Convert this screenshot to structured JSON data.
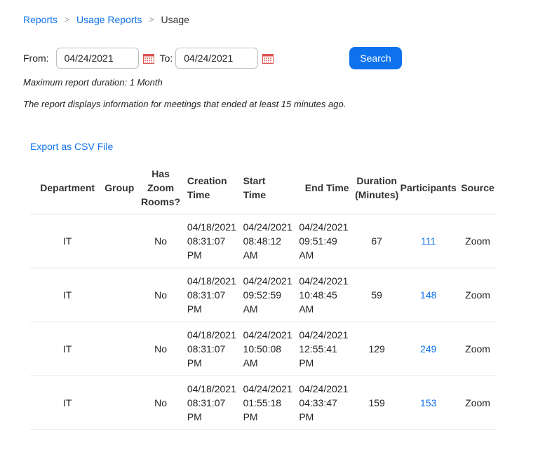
{
  "breadcrumb": {
    "items": [
      "Reports",
      "Usage Reports"
    ],
    "separator": ">",
    "current": "Usage"
  },
  "filters": {
    "from_label": "From:",
    "from_value": "04/24/2021",
    "to_label": "To:",
    "to_value": "04/24/2021",
    "search_label": "Search"
  },
  "notes": {
    "max_duration": "Maximum report duration: 1 Month",
    "info": "The report displays information for meetings that ended at least 15 minutes ago."
  },
  "export_label": "Export as CSV File",
  "table": {
    "headers": {
      "department": "Department",
      "group": "Group",
      "zoom_rooms": [
        "Has",
        "Zoom",
        "Rooms?"
      ],
      "creation_time": [
        "Creation",
        "Time"
      ],
      "start_time": [
        "Start",
        "Time"
      ],
      "end_time": "End Time",
      "duration": [
        "Duration",
        "(Minutes)"
      ],
      "participants": "Participants",
      "source": "Source"
    },
    "rows": [
      {
        "department": "IT",
        "group": "",
        "zoom_rooms": "No",
        "creation": [
          "04/18/2021",
          "08:31:07",
          "PM"
        ],
        "start": [
          "04/24/2021",
          "08:48:12",
          "AM"
        ],
        "end": [
          "04/24/2021",
          "09:51:49",
          "AM"
        ],
        "duration": "67",
        "participants": "111",
        "source": "Zoom"
      },
      {
        "department": "IT",
        "group": "",
        "zoom_rooms": "No",
        "creation": [
          "04/18/2021",
          "08:31:07",
          "PM"
        ],
        "start": [
          "04/24/2021",
          "09:52:59",
          "AM"
        ],
        "end": [
          "04/24/2021",
          "10:48:45",
          "AM"
        ],
        "duration": "59",
        "participants": "148",
        "source": "Zoom"
      },
      {
        "department": "IT",
        "group": "",
        "zoom_rooms": "No",
        "creation": [
          "04/18/2021",
          "08:31:07",
          "PM"
        ],
        "start": [
          "04/24/2021",
          "10:50:08",
          "AM"
        ],
        "end": [
          "04/24/2021",
          "12:55:41",
          "PM"
        ],
        "duration": "129",
        "participants": "249",
        "source": "Zoom"
      },
      {
        "department": "IT",
        "group": "",
        "zoom_rooms": "No",
        "creation": [
          "04/18/2021",
          "08:31:07",
          "PM"
        ],
        "start": [
          "04/24/2021",
          "01:55:18",
          "PM"
        ],
        "end": [
          "04/24/2021",
          "04:33:47",
          "PM"
        ],
        "duration": "159",
        "participants": "153",
        "source": "Zoom"
      }
    ]
  },
  "colors": {
    "accent": "#0e72ed",
    "calendar_icon": "#d9534f"
  },
  "icons": {
    "calendar": "calendar-icon"
  }
}
